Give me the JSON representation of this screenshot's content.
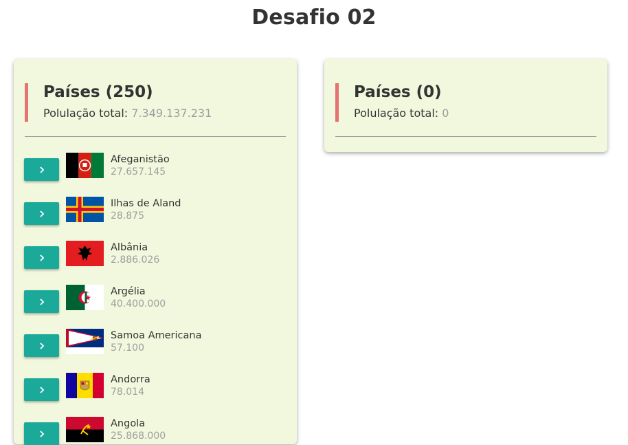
{
  "page": {
    "title": "Desafio 02"
  },
  "left_panel": {
    "title": "Países (250)",
    "population_label": "Polulação total:",
    "population_value": "7.349.137.231"
  },
  "right_panel": {
    "title": "Países (0)",
    "population_label": "Polulação total:",
    "population_value": "0"
  },
  "countries": [
    {
      "name": "Afeganistão",
      "population": "27.657.145",
      "flag": "afghanistan-flag"
    },
    {
      "name": "Ilhas de Aland",
      "population": "28.875",
      "flag": "aland-flag"
    },
    {
      "name": "Albânia",
      "population": "2.886.026",
      "flag": "albania-flag"
    },
    {
      "name": "Argélia",
      "population": "40.400.000",
      "flag": "algeria-flag"
    },
    {
      "name": "Samoa Americana",
      "population": "57.100",
      "flag": "american-samoa-flag"
    },
    {
      "name": "Andorra",
      "population": "78.014",
      "flag": "andorra-flag"
    },
    {
      "name": "Angola",
      "population": "25.868.000",
      "flag": "angola-flag"
    }
  ],
  "colors": {
    "accent_button": "#1ba99a",
    "panel_bg": "#f1f8dd",
    "header_bar": "#e57373",
    "muted_text": "#9e9e9e"
  },
  "icons": {
    "add_button": "chevron-right-icon"
  }
}
